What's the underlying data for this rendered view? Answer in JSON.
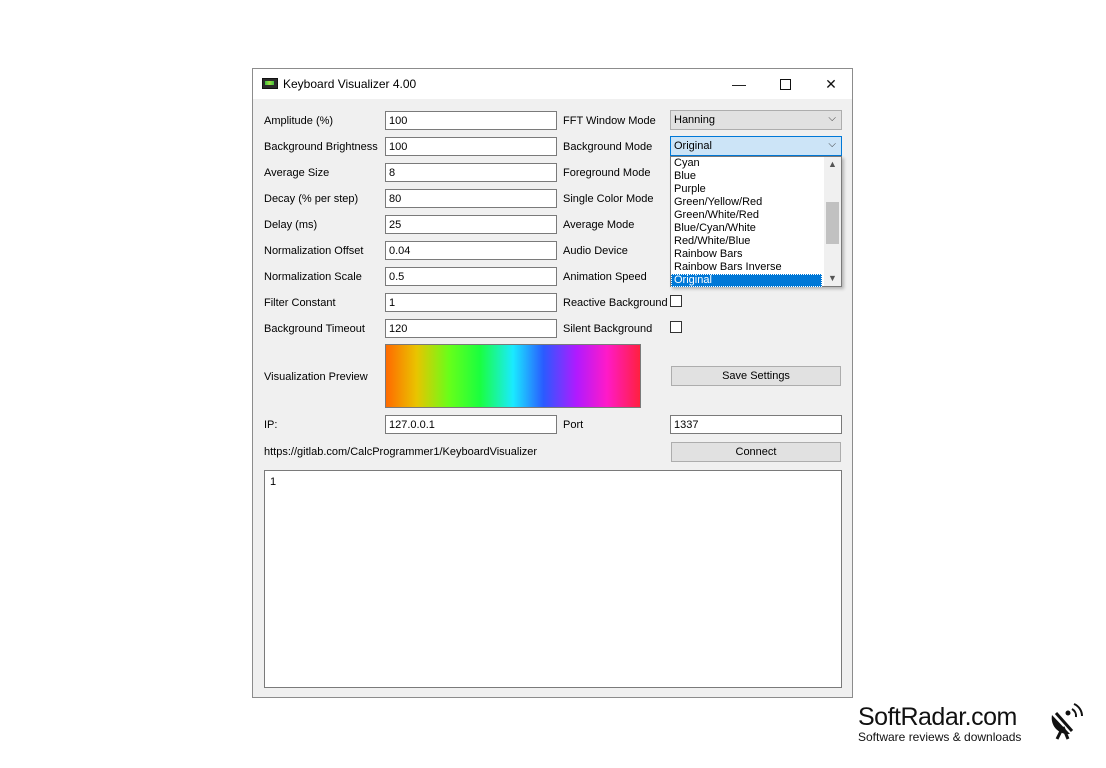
{
  "window": {
    "title": "Keyboard Visualizer 4.00",
    "min_glyph": "—",
    "close_glyph": "✕"
  },
  "left_fields": [
    {
      "label": "Amplitude (%)",
      "value": "100"
    },
    {
      "label": "Background Brightness",
      "value": "100"
    },
    {
      "label": "Average Size",
      "value": "8"
    },
    {
      "label": "Decay (% per step)",
      "value": "80"
    },
    {
      "label": "Delay (ms)",
      "value": "25"
    },
    {
      "label": "Normalization Offset",
      "value": "0.04"
    },
    {
      "label": "Normalization Scale",
      "value": "0.5"
    },
    {
      "label": "Filter Constant",
      "value": "1"
    },
    {
      "label": "Background Timeout",
      "value": "120"
    }
  ],
  "right_labels": {
    "fft_window_mode": "FFT Window Mode",
    "background_mode": "Background Mode",
    "foreground_mode": "Foreground Mode",
    "single_color_mode": "Single Color Mode",
    "average_mode": "Average Mode",
    "audio_device": "Audio Device",
    "animation_speed": "Animation Speed",
    "reactive_background": "Reactive Background",
    "silent_background": "Silent Background"
  },
  "combos": {
    "fft_window_mode": "Hanning",
    "background_mode": "Original"
  },
  "dropdown": {
    "items": [
      "Cyan",
      "Blue",
      "Purple",
      "Green/Yellow/Red",
      "Green/White/Red",
      "Blue/Cyan/White",
      "Red/White/Blue",
      "Rainbow Bars",
      "Rainbow Bars Inverse",
      "Original"
    ],
    "selected": "Original"
  },
  "checkboxes": {
    "reactive_background": false,
    "silent_background": false
  },
  "preview_label": "Visualization Preview",
  "save_button": "Save Settings",
  "ip": {
    "label": "IP:",
    "value": "127.0.0.1"
  },
  "port": {
    "label": "Port",
    "value": "1337"
  },
  "url": "https://gitlab.com/CalcProgrammer1/KeyboardVisualizer",
  "connect_button": "Connect",
  "log_text": "1",
  "watermark": {
    "title": "SoftRadar.com",
    "subtitle": "Software reviews & downloads"
  },
  "icons": {
    "app": "keyboard-icon",
    "chevron": "⌵",
    "scroll_up": "▲",
    "scroll_down": "▼"
  },
  "colors": {
    "selection": "#0078d7",
    "window_bg": "#f0f0f0"
  }
}
